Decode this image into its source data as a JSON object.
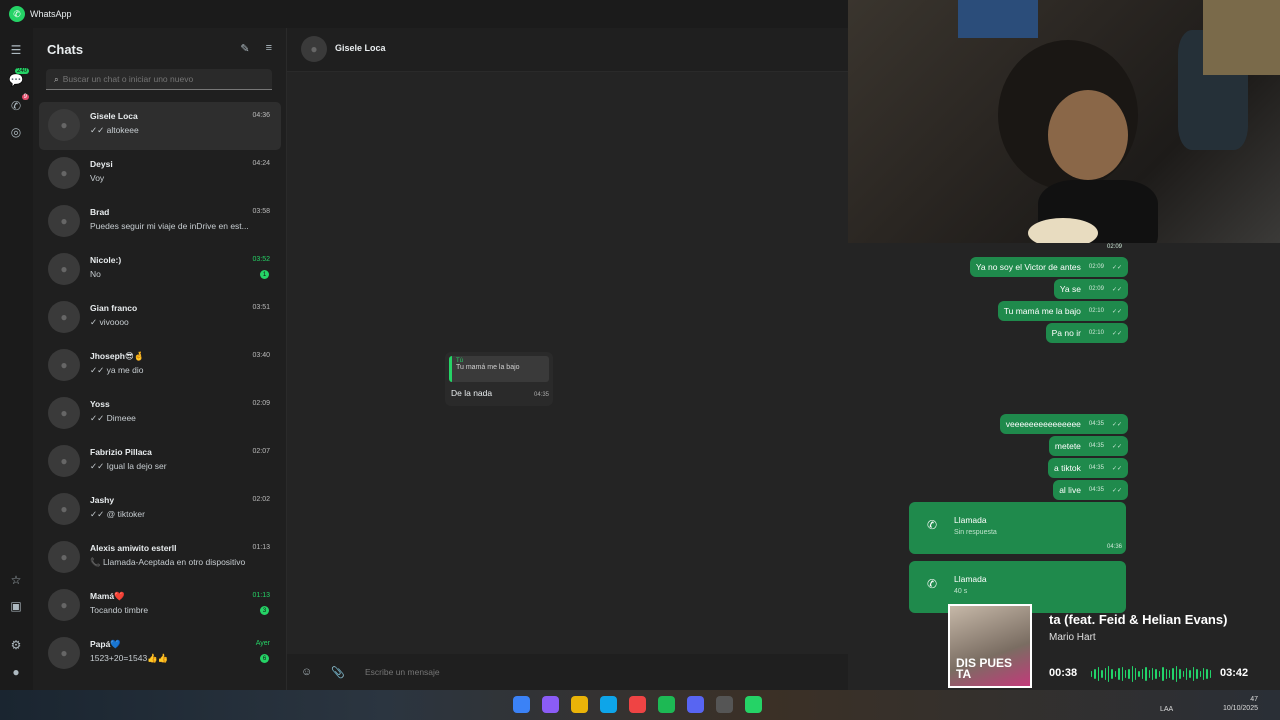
{
  "app": {
    "title": "WhatsApp"
  },
  "rail": {
    "chats_badge": "240",
    "calls_badge": "9"
  },
  "sidebar": {
    "title": "Chats",
    "search_placeholder": "Buscar un chat o iniciar uno nuevo",
    "chats": [
      {
        "name": "Gisele Loca",
        "preview": "✓✓ altokeee",
        "time": "04:36",
        "active": true
      },
      {
        "name": "Deysi",
        "preview": "Voy",
        "time": "04:24"
      },
      {
        "name": "Brad",
        "preview": "Puedes seguir mi viaje de inDrive en est...",
        "time": "03:58"
      },
      {
        "name": "Nicole:)",
        "preview": "No",
        "time": "03:52",
        "unread": "1"
      },
      {
        "name": "Gian franco",
        "preview": "✓ vivoooo",
        "time": "03:51"
      },
      {
        "name": "Jhoseph😎🤞",
        "preview": "✓✓ ya me dio",
        "time": "03:40"
      },
      {
        "name": "Yoss",
        "preview": "✓✓ Dimeee",
        "time": "02:09"
      },
      {
        "name": "Fabrizio Pillaca",
        "preview": "✓✓ Igual la dejo ser",
        "time": "02:07"
      },
      {
        "name": "Jashy",
        "preview": "✓✓ @ tiktoker",
        "time": "02:02"
      },
      {
        "name": "Alexis amiwito esterll",
        "preview": "📞 Llamada-Aceptada en otro dispositivo",
        "time": "01:13"
      },
      {
        "name": "Mamá❤️",
        "preview": "Tocando timbre",
        "time": "01:13",
        "unread": "3"
      },
      {
        "name": "Papá💙",
        "preview": "1523+20=1543👍👍",
        "time": "Ayer",
        "unread": "6"
      }
    ]
  },
  "chat": {
    "contact": "Gisele Loca",
    "reply": {
      "quoted_author": "Tú",
      "quoted_text": "Tu mamá me la bajo",
      "text": "De la nada",
      "time": "04:35"
    },
    "composer_placeholder": "Escribe un mensaje",
    "sent": [
      {
        "text": "Ya no soy el Victor de antes",
        "time": "02:09"
      },
      {
        "text": "Ya se",
        "time": "02:09"
      },
      {
        "text": "Tu mamá me la bajo",
        "time": "02:10"
      },
      {
        "text": "Pa no ir",
        "time": "02:10"
      },
      {
        "text": "veeeeeeeeeeeeeee",
        "time": "04:35"
      },
      {
        "text": "metete",
        "time": "04:35"
      },
      {
        "text": "a tiktok",
        "time": "04:35"
      },
      {
        "text": "al live",
        "time": "04:35"
      }
    ],
    "top_time": "02:09",
    "calls": [
      {
        "label": "Llamada",
        "sub": "Sin respuesta",
        "time": "04:36"
      },
      {
        "label": "Llamada",
        "sub": "40 s",
        "time": ""
      }
    ]
  },
  "player": {
    "title": "ta (feat. Feid & Helian Evans)",
    "artist": "Mario Hart",
    "elapsed": "00:38",
    "total": "03:42",
    "cover_text": "DIS PUES TA",
    "progress": 0.17
  },
  "taskbar": {
    "lang": "LAA",
    "time": "47",
    "date": "10/10/2025"
  },
  "colors": {
    "accent": "#25d366",
    "bubble_out": "#1f8a4c",
    "bg": "#1f1f1f"
  }
}
